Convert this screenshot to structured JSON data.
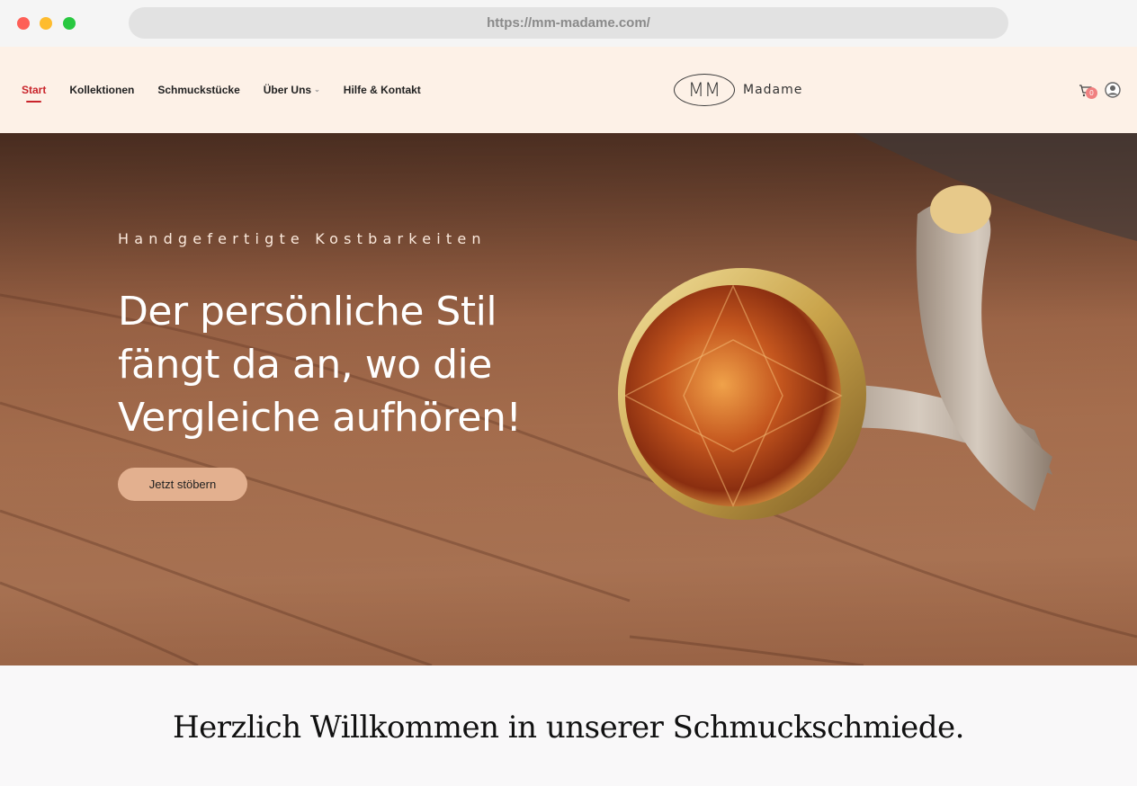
{
  "browser": {
    "url": "https://mm-madame.com/"
  },
  "header": {
    "nav": [
      {
        "label": "Start",
        "active": true
      },
      {
        "label": "Kollektionen",
        "active": false
      },
      {
        "label": "Schmuckstücke",
        "active": false
      },
      {
        "label": "Über Uns",
        "active": false,
        "has_dropdown": true
      },
      {
        "label": "Hilfe & Kontakt",
        "active": false
      }
    ],
    "logo": {
      "mark": "MM",
      "name": "Madame"
    },
    "cart": {
      "count": "0",
      "icon": "cart-icon"
    },
    "account": {
      "icon": "user-icon"
    }
  },
  "hero": {
    "kicker": "Handgefertigte Kostbarkeiten",
    "title": "Der persönliche Stil fängt da an, wo die Vergleiche aufhören!",
    "button": "Jetzt stöbern"
  },
  "welcome": {
    "title": "Herzlich Willkommen in unserer Schmuckschmiede."
  },
  "colors": {
    "accent_red": "#c9242b",
    "header_bg": "#fdf1e7",
    "button_bg": "#e3b08f"
  }
}
